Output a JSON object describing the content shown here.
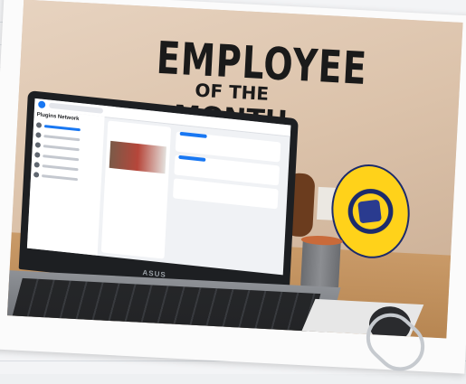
{
  "photo": {
    "poster": {
      "line1": "EMPLOYEE",
      "line2": "OF THE",
      "line3": "MONTH"
    },
    "laptop": {
      "brand": "ASUS"
    },
    "screen": {
      "app": "facebook",
      "sidebar_title": "Plugins Network"
    }
  },
  "colors": {
    "wall": "#dcc3ab",
    "desk": "#c99a68",
    "accent_blue": "#1877f2",
    "ball_yellow": "#ffd21a",
    "ball_navy": "#1c2b6b"
  }
}
